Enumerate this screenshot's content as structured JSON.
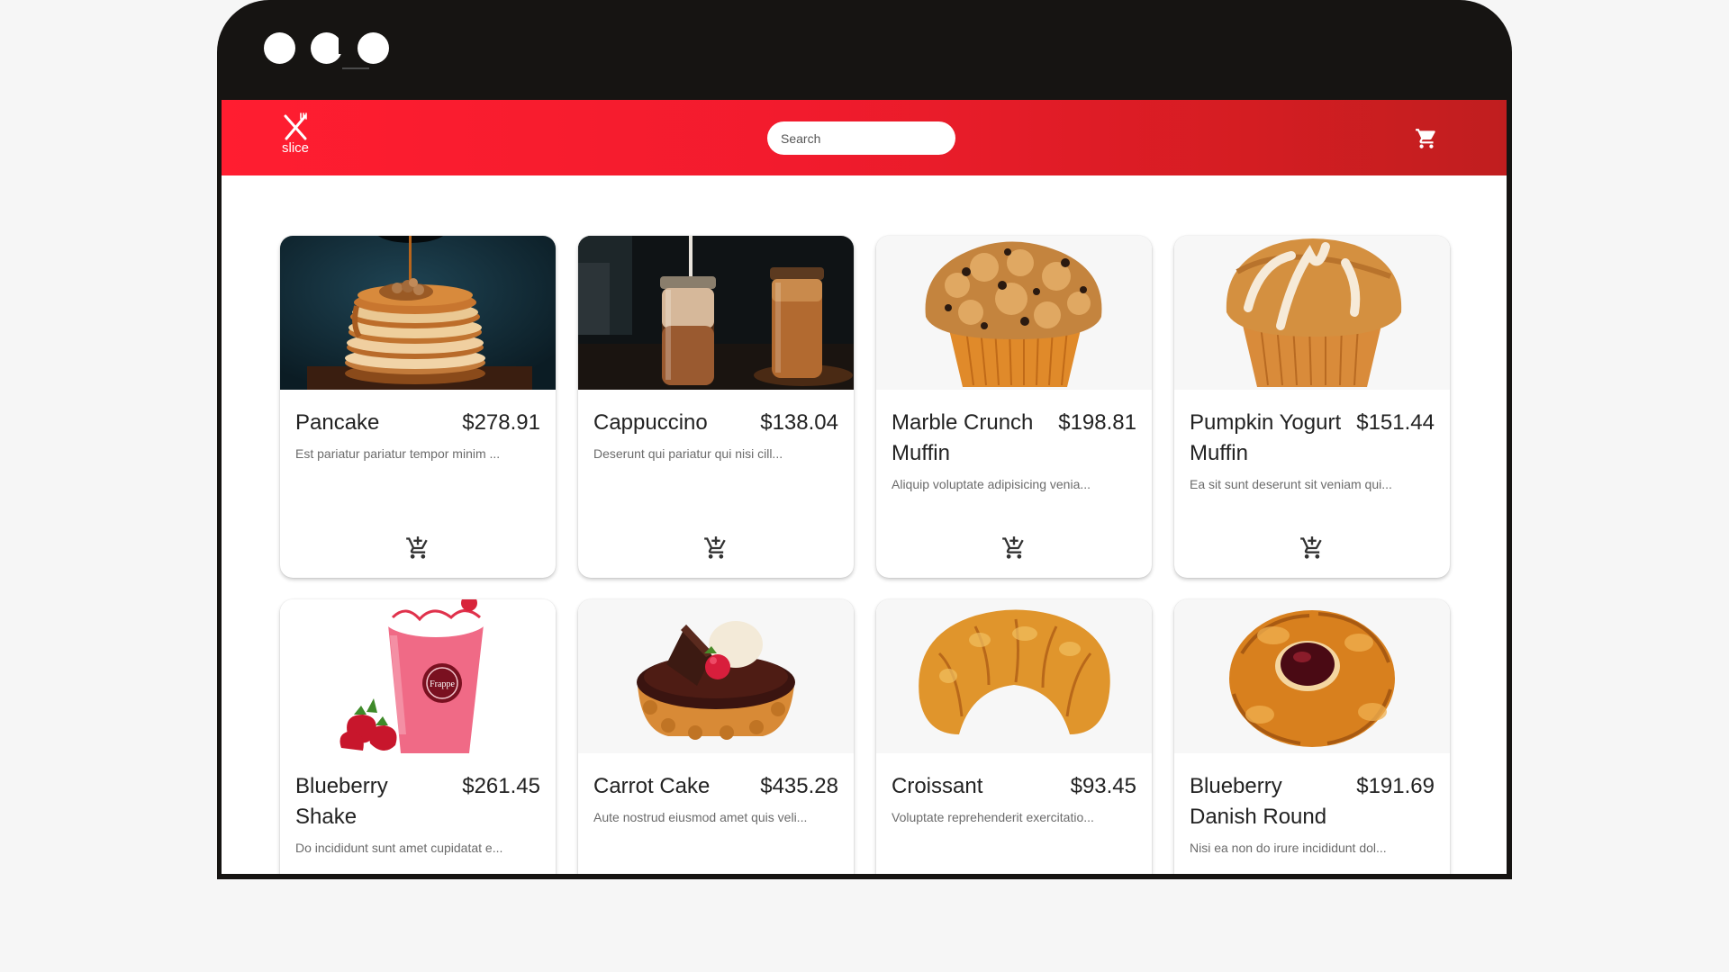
{
  "app": {
    "brand": "slice",
    "search_placeholder": "Search"
  },
  "products": [
    {
      "name": "Pancake",
      "price": "$278.91",
      "description": "Est pariatur pariatur tempor minim ...",
      "image": "pancake-stack"
    },
    {
      "name": "Cappuccino",
      "price": "$138.04",
      "description": "Deserunt qui pariatur qui nisi cill...",
      "image": "iced-coffee-jars"
    },
    {
      "name": "Marble Crunch Muffin",
      "price": "$198.81",
      "description": "Aliquip voluptate adipisicing venia...",
      "image": "crunch-muffin"
    },
    {
      "name": "Pumpkin Yogurt Muffin",
      "price": "$151.44",
      "description": "Ea sit sunt deserunt sit veniam qui...",
      "image": "iced-muffin"
    },
    {
      "name": "Blueberry Shake",
      "price": "$261.45",
      "description": "Do incididunt sunt amet cupidatat e...",
      "image": "strawberry-frappe",
      "image_text": "Frappe"
    },
    {
      "name": "Carrot Cake",
      "price": "$435.28",
      "description": "Aute nostrud eiusmod amet quis veli...",
      "image": "chocolate-tart"
    },
    {
      "name": "Croissant",
      "price": "$93.45",
      "description": "Voluptate reprehenderit exercitatio...",
      "image": "croissant"
    },
    {
      "name": "Blueberry Danish Round",
      "price": "$191.69",
      "description": "Nisi ea non do irure incididunt dol...",
      "image": "jam-danish"
    }
  ],
  "colors": {
    "header_start": "#ff1d30",
    "header_end": "#c01e1f",
    "frame": "#161412",
    "background": "#f6f6f6"
  },
  "icons": {
    "logo": "fork-knife-icon",
    "cart": "shopping-cart-icon",
    "add_to_cart": "add-shopping-cart-icon"
  }
}
